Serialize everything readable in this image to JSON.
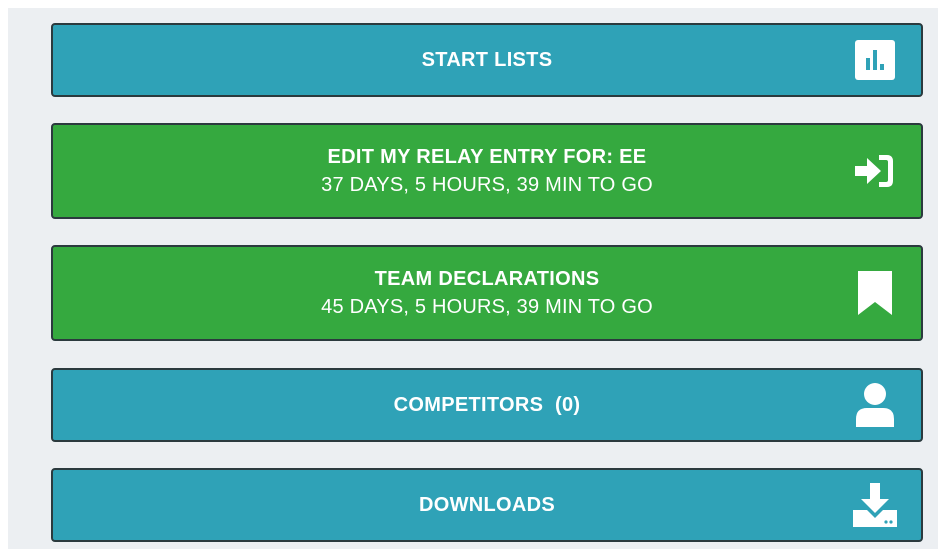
{
  "buttons": {
    "start_lists": {
      "title": "START LISTS",
      "icon": "bar-chart-icon"
    },
    "relay_entry": {
      "title": "EDIT MY RELAY ENTRY FOR: EE",
      "subtitle": "37 DAYS, 5 HOURS, 39 MIN TO GO",
      "icon": "sign-in-icon"
    },
    "team_declarations": {
      "title": "TEAM DECLARATIONS",
      "subtitle": "45 DAYS, 5 HOURS, 39 MIN TO GO",
      "icon": "bookmark-icon"
    },
    "competitors": {
      "title": "COMPETITORS  (0)",
      "icon": "user-icon"
    },
    "downloads": {
      "title": "DOWNLOADS",
      "icon": "download-icon"
    }
  },
  "colors": {
    "teal": "#2fa2b7",
    "green": "#35a93f",
    "panel_bg": "#eceff2",
    "border": "#2b3a3e"
  }
}
